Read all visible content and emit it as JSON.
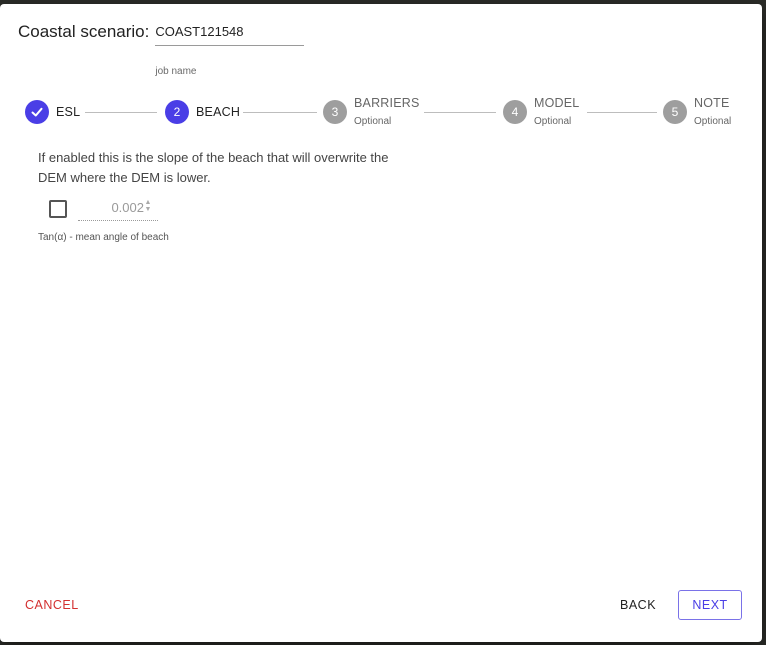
{
  "dialog": {
    "title_label": "Coastal scenario:",
    "job_name_value": "COAST121548",
    "job_name_helper": "job name"
  },
  "stepper": {
    "steps": [
      {
        "number": "",
        "label": "ESL",
        "optional": "",
        "state": "completed"
      },
      {
        "number": "2",
        "label": "BEACH",
        "optional": "",
        "state": "active"
      },
      {
        "number": "3",
        "label": "BARRIERS",
        "optional": "Optional",
        "state": "inactive"
      },
      {
        "number": "4",
        "label": "MODEL",
        "optional": "Optional",
        "state": "inactive"
      },
      {
        "number": "5",
        "label": "NOTE",
        "optional": "Optional",
        "state": "inactive"
      }
    ]
  },
  "beach": {
    "description": "If enabled this is the slope of the beach that will overwrite the DEM where the DEM is lower.",
    "slope_value": "0.002",
    "checkbox_checked": false,
    "helper": "Tan(α) - mean angle of beach"
  },
  "footer": {
    "cancel_label": "CANCEL",
    "back_label": "BACK",
    "next_label": "NEXT"
  },
  "colors": {
    "accent": "#4a3ee6",
    "inactive_step": "#9e9e9e",
    "cancel": "#d32f2f"
  }
}
